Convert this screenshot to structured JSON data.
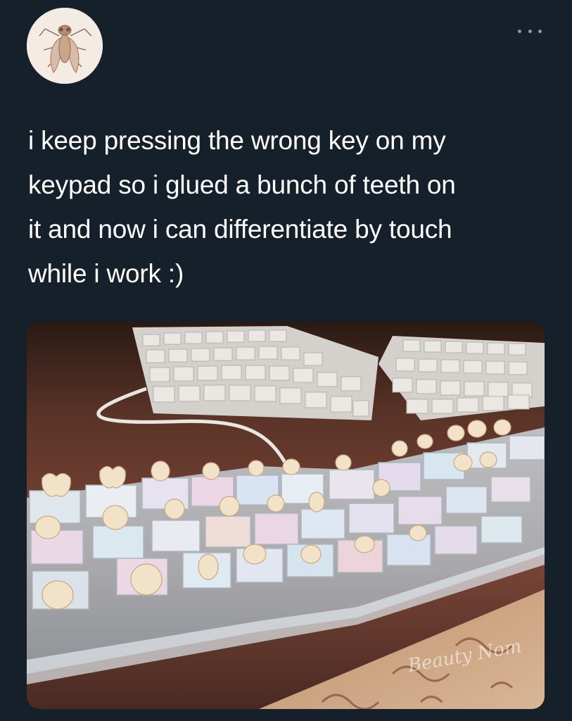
{
  "tweet": {
    "avatar_icon": "fly-icon",
    "more_icon": "more-options-icon",
    "text_lines": [
      "i keep pressing the wrong key on my",
      "keypad so i glued a bunch of teeth on",
      "it and now i can differentiate by touch",
      "while i work :)"
    ],
    "media": {
      "watermark": "Beauty Nom"
    }
  },
  "colors": {
    "background": "#15202b",
    "text": "#ffffff",
    "icon": "#8899a6"
  }
}
